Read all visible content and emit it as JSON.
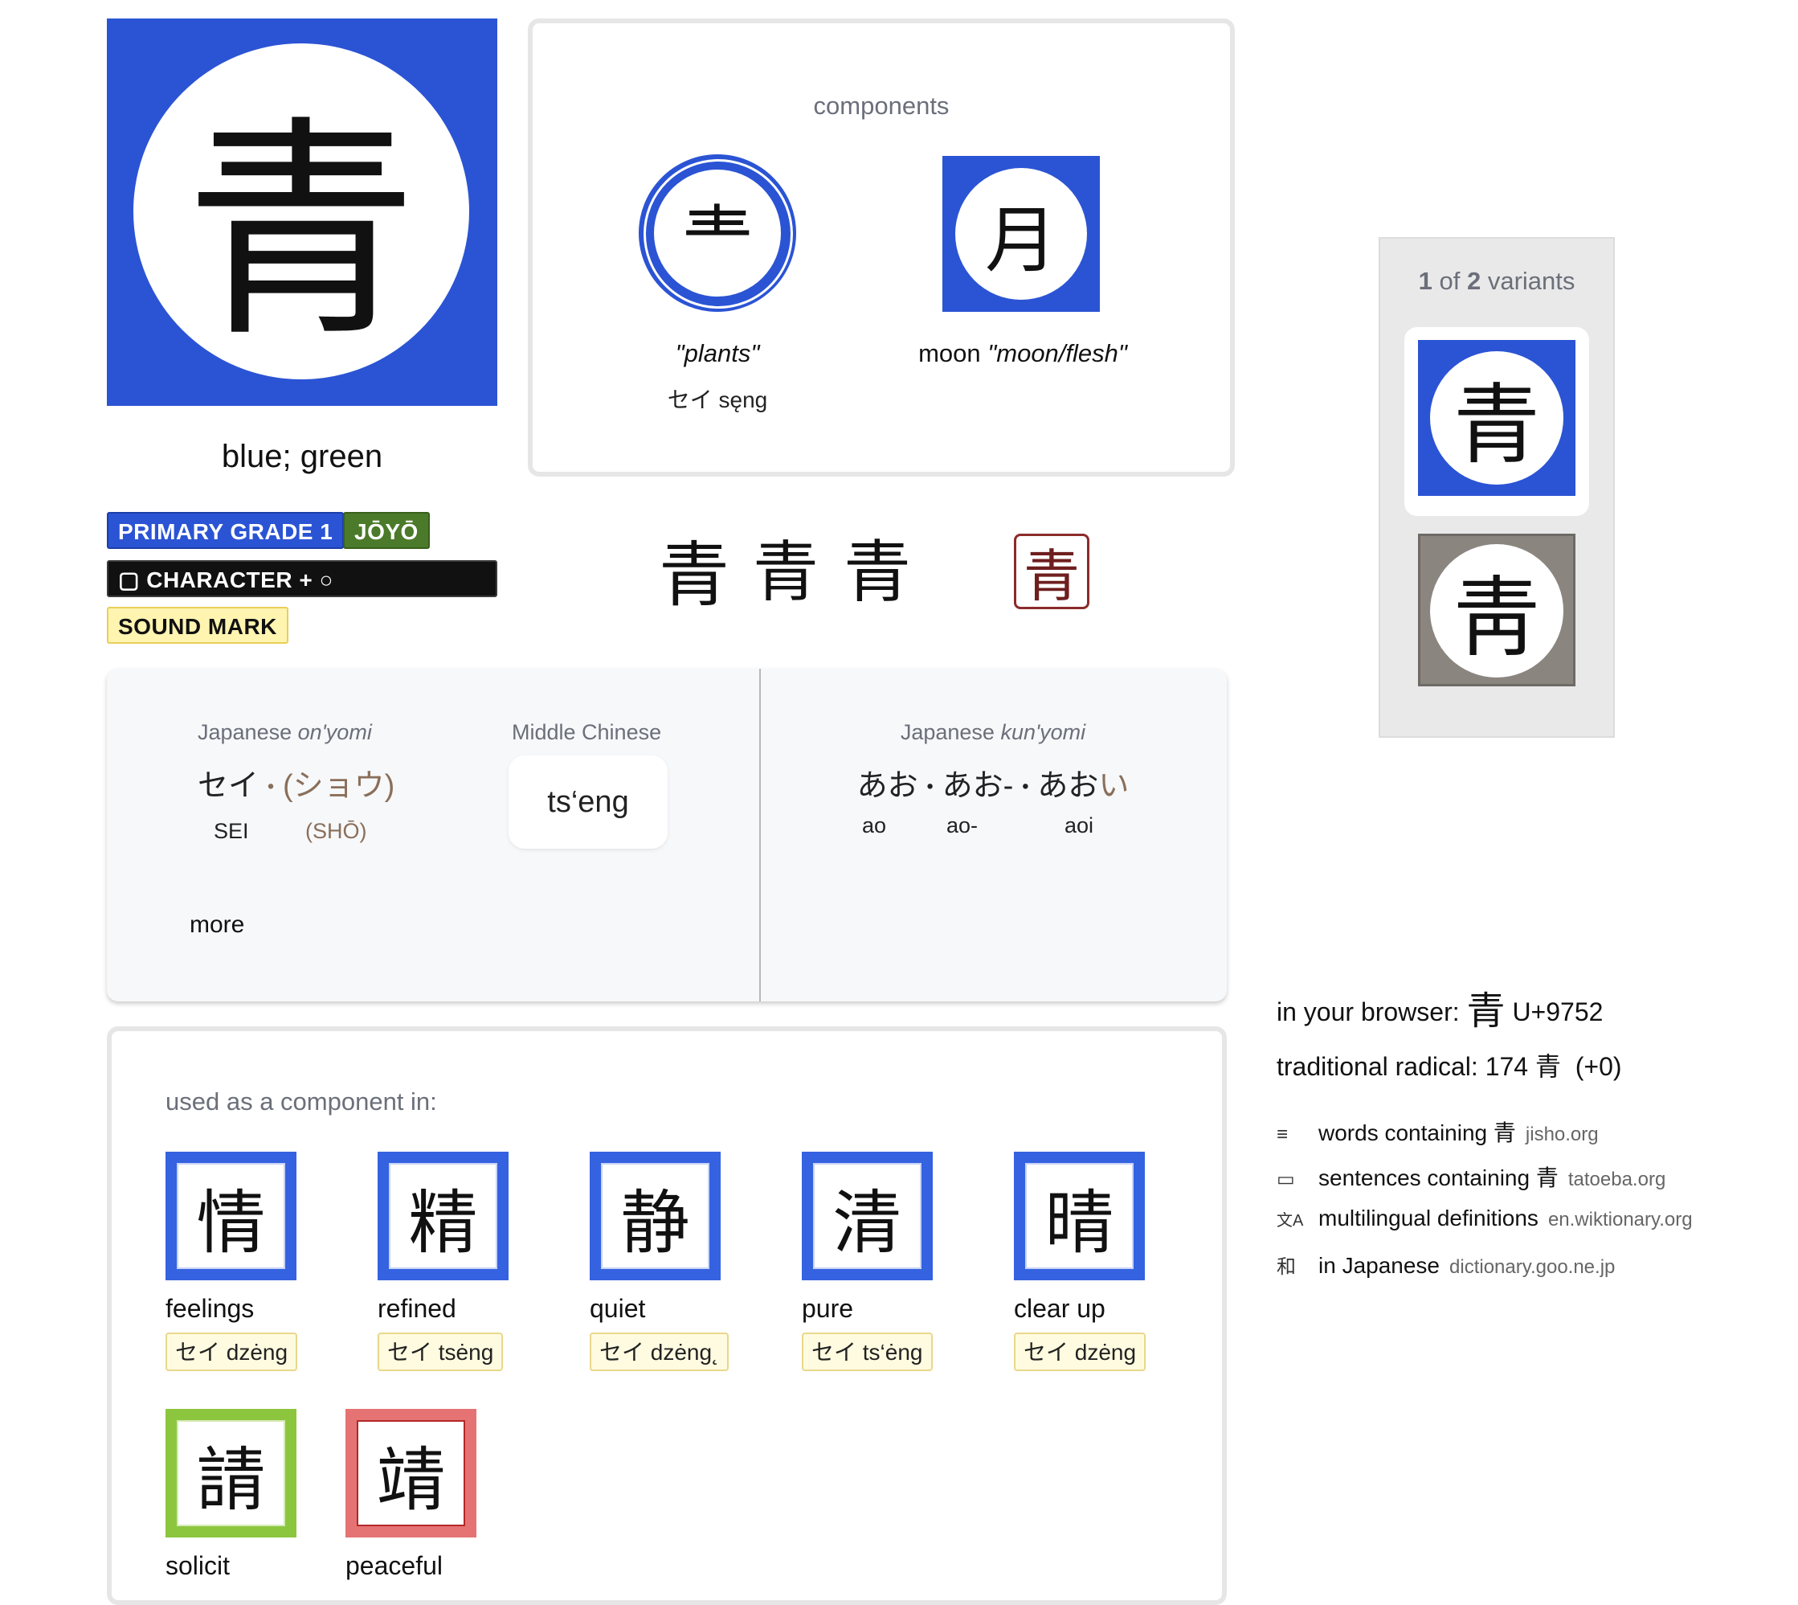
{
  "main_kanji": "青",
  "meaning": "blue; green",
  "tags": {
    "grade": "PRIMARY GRADE 1",
    "joyo": "JŌYŌ",
    "structure": "▢ CHARACTER + ○ COMPONENT",
    "role": "SOUND MARK"
  },
  "components": {
    "heading": "components",
    "items": [
      {
        "glyph": "龶",
        "label": "\"plants\"",
        "reading": "セイ sęng"
      },
      {
        "glyph": "月",
        "word": "moon",
        "label": "\"moon/flesh\""
      }
    ]
  },
  "glyph_variants": [
    "青",
    "青",
    "青"
  ],
  "seal_glyph": "青",
  "variants_panel": {
    "current": "1",
    "total": "2",
    "of_text": "of",
    "suffix": "variants",
    "items": [
      "青",
      "靑"
    ]
  },
  "readings": {
    "onyomi_label": "Japanese",
    "onyomi_label_italic": "on'yomi",
    "onyomi_main": "セイ",
    "onyomi_sep": "・",
    "onyomi_alt": "(ショウ)",
    "onyomi_main_romaji": "SEI",
    "onyomi_alt_romaji": "(SHŌ)",
    "middle_chinese_label": "Middle Chinese",
    "middle_chinese": "ts‘eng",
    "more": "more",
    "kunyomi_label": "Japanese",
    "kunyomi_label_italic": "kun'yomi",
    "kunyomi_a": "あお",
    "kunyomi_sep1": "・",
    "kunyomi_b": "あお-",
    "kunyomi_sep2": "・",
    "kunyomi_c": "あお",
    "kunyomi_c_okurigana": "い",
    "kunyomi_romaji": [
      "ao",
      "ao-",
      "aoi"
    ]
  },
  "used_as_component": {
    "heading": "used as a component in:",
    "items": [
      {
        "glyph": "情",
        "meaning": "feelings",
        "reading": "セイ dzėng",
        "color": "#3462e0"
      },
      {
        "glyph": "精",
        "meaning": "refined",
        "reading": "セイ tsėng",
        "color": "#3462e0"
      },
      {
        "glyph": "静",
        "meaning": "quiet",
        "reading": "セイ dzėng˛",
        "color": "#3462e0"
      },
      {
        "glyph": "清",
        "meaning": "pure",
        "reading": "セイ ts‘ėng",
        "color": "#3462e0"
      },
      {
        "glyph": "晴",
        "meaning": "clear up",
        "reading": "セイ dzėng",
        "color": "#3462e0"
      },
      {
        "glyph": "請",
        "meaning": "solicit",
        "color": "#8cc63f"
      },
      {
        "glyph": "靖",
        "meaning": "peaceful",
        "color": "#e57373"
      }
    ]
  },
  "info": {
    "browser_label": "in your browser:",
    "browser_glyph": "青",
    "codepoint": "U+9752",
    "radical_text": "traditional radical: 174 青  (+0)"
  },
  "links": [
    {
      "icon": "≡",
      "text": "words containing 青",
      "site": "jisho.org"
    },
    {
      "icon": "▭",
      "text": "sentences containing 青",
      "site": "tatoeba.org"
    },
    {
      "icon": "文A",
      "text": "multilingual definitions",
      "site": "en.wiktionary.org"
    },
    {
      "icon": "和",
      "text": "in Japanese",
      "site": "dictionary.goo.ne.jp"
    }
  ]
}
